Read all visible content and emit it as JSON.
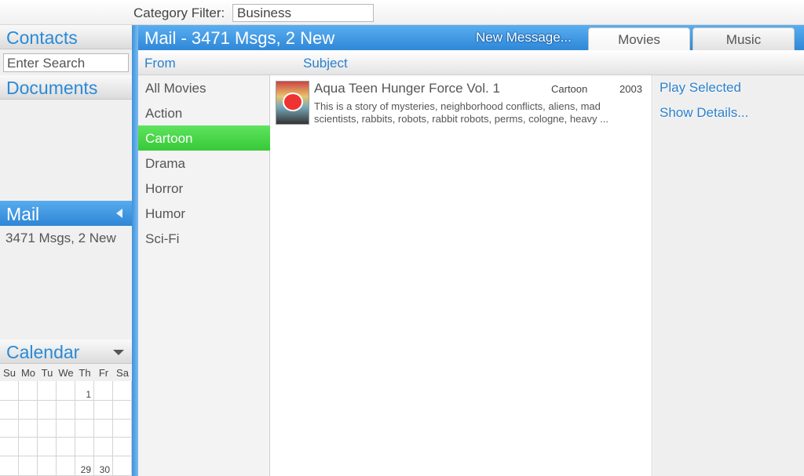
{
  "topbar": {
    "filter_label": "Category Filter:",
    "filter_value": "Business"
  },
  "sidebar": {
    "contacts_title": "Contacts",
    "search_placeholder": "Enter Search",
    "documents_title": "Documents",
    "mail_title": "Mail",
    "mail_summary": "3471 Msgs, 2 New",
    "calendar_title": "Calendar",
    "calendar_days": [
      "Su",
      "Mo",
      "Tu",
      "We",
      "Th",
      "Fr",
      "Sa"
    ],
    "calendar_cells": [
      "",
      "",
      "",
      "",
      "1",
      "",
      "",
      "",
      "",
      "",
      "",
      "",
      "",
      "",
      "",
      "",
      "",
      "",
      "",
      "",
      "",
      "",
      "",
      "",
      "",
      "",
      "",
      "",
      "",
      "",
      "",
      "",
      "29",
      "30",
      ""
    ]
  },
  "main": {
    "title": "Mail - 3471 Msgs, 2 New",
    "new_message": "New Message...",
    "tabs": [
      {
        "label": "Movies",
        "active": true
      },
      {
        "label": "Music",
        "active": false
      }
    ],
    "columns": {
      "from": "From",
      "subject": "Subject"
    }
  },
  "categories": [
    {
      "label": "All Movies",
      "selected": false
    },
    {
      "label": "Action",
      "selected": false
    },
    {
      "label": "Cartoon",
      "selected": true
    },
    {
      "label": "Drama",
      "selected": false
    },
    {
      "label": "Horror",
      "selected": false
    },
    {
      "label": "Humor",
      "selected": false
    },
    {
      "label": "Sci-Fi",
      "selected": false
    }
  ],
  "items": [
    {
      "title": "Aqua Teen Hunger Force Vol. 1",
      "genre": "Cartoon",
      "year": "2003",
      "description": "This is a story of mysteries, neighborhood conflicts, aliens, mad scientists, rabbits, robots, rabbit robots, perms, cologne, heavy ..."
    }
  ],
  "actions": {
    "play_selected": "Play Selected",
    "show_details": "Show Details..."
  },
  "colors": {
    "accent_blue": "#2d86d6",
    "selection_green": "#36c936"
  }
}
